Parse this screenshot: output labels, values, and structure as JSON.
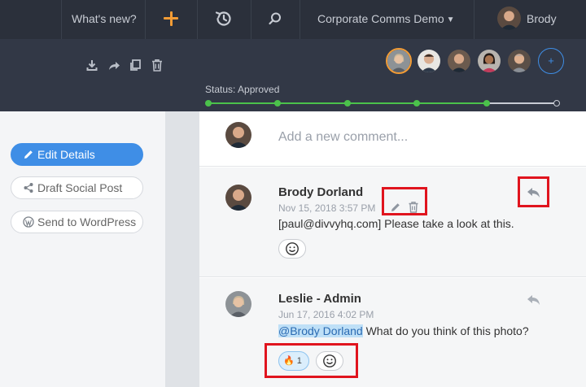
{
  "topnav": {
    "whats_new": "What's new?",
    "workspace": "Corporate Comms Demo",
    "user_name": "Brody"
  },
  "toolbar": {
    "icons": [
      "download-icon",
      "share-icon",
      "copy-icon",
      "trash-icon"
    ],
    "assignee_count_shown": 5,
    "add_assignee": "+",
    "status_text": "Status: Approved",
    "workflow_steps_completed": 5,
    "workflow_steps_total": 6
  },
  "sidebar": {
    "edit_details": "Edit Details",
    "draft_social_post": "Draft Social Post",
    "send_to_wordpress": "Send to WordPress"
  },
  "comments": {
    "new_placeholder": "Add a new comment...",
    "items": [
      {
        "author": "Brody Dorland",
        "date": "Nov 15, 2018 3:57 PM",
        "text": "[paul@divvyhq.com]  Please take a look at this."
      },
      {
        "author": "Leslie - Admin",
        "date": "Jun 17, 2016 4:02 PM",
        "mention": "@Brody Dorland",
        "text": " What do you think of this photo?",
        "reaction_emoji": "🔥",
        "reaction_count": "1"
      }
    ]
  },
  "colors": {
    "nav_bg": "#2b303b",
    "subhead_bg": "#323846",
    "accent_orange": "#f39c35",
    "accent_blue": "#3f8ee6",
    "status_green": "#4bc24b",
    "highlight_red": "#e0141e"
  }
}
